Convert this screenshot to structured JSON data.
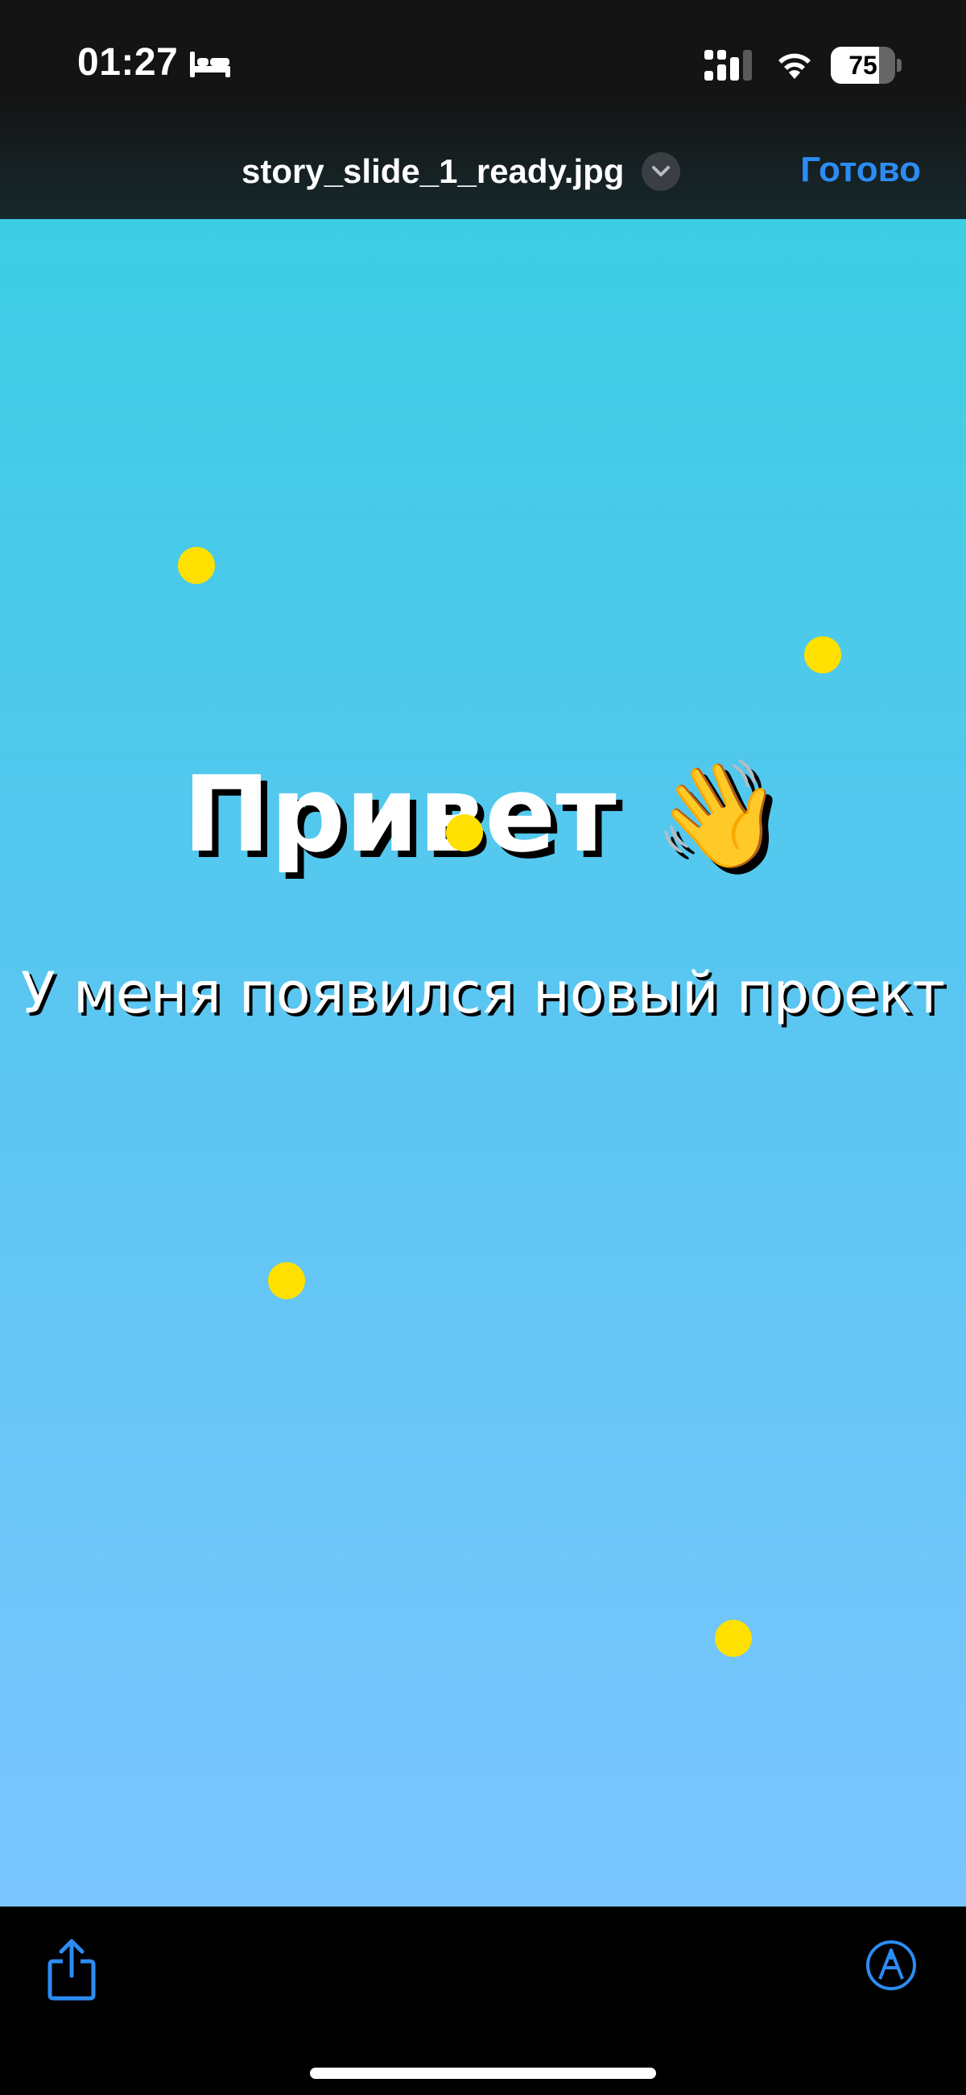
{
  "status_bar": {
    "time": "01:27",
    "focus_icon": "bed-icon",
    "signal_icon": "cellular-signal-icon",
    "wifi_icon": "wifi-icon",
    "battery_level": "75"
  },
  "nav_bar": {
    "file_name": "story_slide_1_ready.jpg",
    "file_menu_icon": "chevron-down-icon",
    "done_label": "Готово",
    "accent_color": "#2c8cf4"
  },
  "preview": {
    "headline": "Привет 👋",
    "subline": "У меня появился новый проект",
    "dot_color": "#ffe000",
    "background_top": "#3ccde4",
    "background_bottom": "#7ac5fe"
  },
  "toolbar": {
    "share_icon": "share-icon",
    "markup_icon": "markup-icon"
  }
}
